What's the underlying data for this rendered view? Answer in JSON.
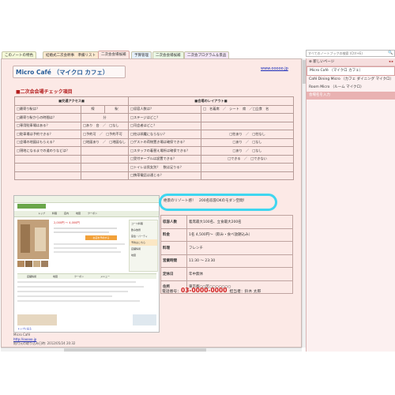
{
  "tabs": [
    "このノートの特色",
    "結婚式二次会幹事　準備リスト",
    "二次会会場候補",
    "予算管理",
    "二次会会場候補",
    "二次会プログラム＆景品"
  ],
  "search": {
    "placeholder": "すべてのノートブックの検索 (Ctrl+E)"
  },
  "page": {
    "title": "Micro Café （マイクロ カフェ）",
    "url": "www.ooooo.jp",
    "check_title": "■二次会会場チェック項目",
    "access_header": "■交通アクセス■",
    "layout_header": "■会場のレイアウト■",
    "rows": [
      [
        "□最寄り駅は？",
        "線",
        "駅",
        "□収容人数は？",
        "□　名着席　／　シート　席　／□立食　名"
      ],
      [
        "□最寄り駅からの時間は？",
        "分",
        "",
        "□ステージはどこ？",
        ""
      ],
      [
        "□専用駐車場はある？",
        "□あり　台　／　□なし",
        "",
        "□司会者はどこ？",
        ""
      ],
      [
        "□駐車場は予約できる？",
        "□予約可　／　□予約不可",
        "",
        "□柱は邪魔にならない？",
        "□柱あり　／　□柱なし"
      ],
      [
        "□会場の地図はもらえる？",
        "□地図あり　／　□地図なし",
        "",
        "□ゲストの荷物置き場は確保できる？",
        "□あり　／　□なし"
      ],
      [
        "□現地になるまでの道のりなどは？",
        "",
        "",
        "□スタッフの着替え場所は確保できる？",
        "□あり　／　□なし"
      ],
      [
        "",
        "",
        "",
        "□受付テーブルは設置できる？",
        "□できる　／　□できない"
      ],
      [
        "",
        "",
        "",
        "□トイレは男女別？　数は足りる？",
        ""
      ],
      [
        "",
        "",
        "",
        "□携帯電話は通じる？",
        ""
      ]
    ],
    "callout": "絶景のリゾート感！　200名収容OKのモダン空間！",
    "info": [
      [
        "収容人数",
        "着席最大100名、立食最大200名"
      ],
      [
        "料金",
        "1名 4,500円～（飲み・食べ放題込み）"
      ],
      [
        "料理",
        "フレンチ"
      ],
      [
        "営業時間",
        "11:30 ～ 23:30"
      ],
      [
        "定休日",
        "年中無休"
      ],
      [
        "住所",
        "東京都○○区○○○○○○○"
      ]
    ],
    "phone_label": "電話番号：",
    "phone": "03-0000-0000",
    "manager": "担当者：鈴木 太郎",
    "footer_name": "Micro Café",
    "footer_url": "http://ooooo.jp",
    "footer_date": "貼付元の取り込み日時: 2012/05/24 20:32",
    "shot": {
      "header_tabs": [
        "トップ",
        "料理",
        "店内",
        "地図",
        "クーポン"
      ],
      "menu_items": [
        "コース料理",
        "飲み放題",
        "宴会・パーティ",
        "予約はこちら",
        "店舗情報",
        "地図"
      ],
      "price_line": "2,000円 ～ 4,000円",
      "reserve": "お店を予約する",
      "tabs_bottom": [
        "店舗情報",
        "地図",
        "クーポン",
        "メニュー"
      ],
      "footer_link": "トップに戻る"
    }
  },
  "panel": {
    "new_page": "新しいページ",
    "items": [
      "Micro Café （マイクロ カフェ）",
      "Café Dining Micro （カフェ ダイニング マイクロ）",
      "Room Micro （ルーム マイクロ）",
      "会場名を入力"
    ]
  },
  "colors": {
    "accent": "#e9b2b2",
    "page_bg": "#fce9e6",
    "title_blue": "#2a5f9a",
    "red": "#d21f1f",
    "cyan": "#3fd6f0"
  }
}
